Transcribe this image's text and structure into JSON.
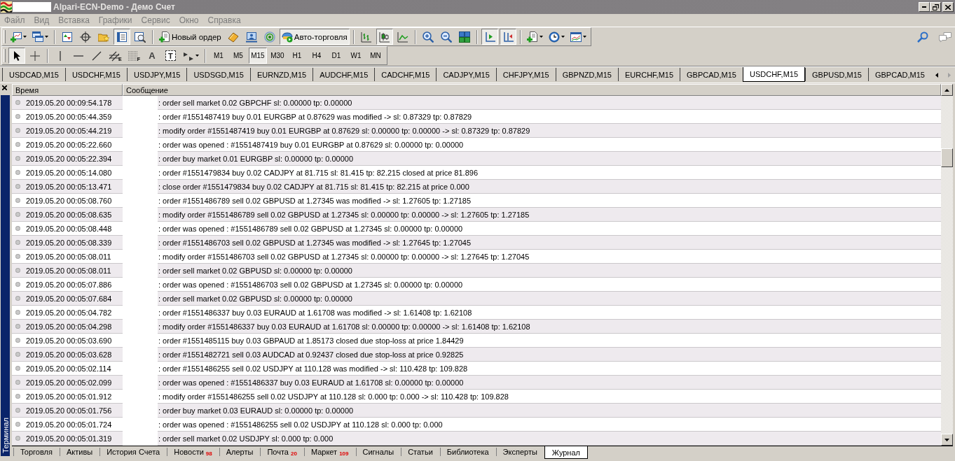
{
  "window": {
    "title": "Alpari-ECN-Demo - Демо Счет",
    "active": false
  },
  "menu": [
    "Файл",
    "Вид",
    "Вставка",
    "Графики",
    "Сервис",
    "Окно",
    "Справка"
  ],
  "main_toolbar": {
    "terminal": {
      "on": true
    },
    "new_order": {
      "label": "Новый ордер"
    },
    "auto_trading": {
      "label": "Авто-торговля",
      "on": true
    },
    "chart_types": [
      {
        "selected": false
      },
      {
        "selected": true
      },
      {
        "selected": false
      }
    ],
    "auto_scroll": {
      "on": true
    },
    "chart_shift": {
      "on": true
    }
  },
  "drawing_toolbar": {
    "cursor_modes": [
      {
        "selected": true
      },
      {
        "selected": false
      }
    ],
    "channel_mark": "E",
    "fibo_mark": "F",
    "text_tool": "A",
    "label_tool": "T"
  },
  "timeframes": [
    {
      "label": "M1",
      "selected": false
    },
    {
      "label": "M5",
      "selected": false
    },
    {
      "label": "M15",
      "selected": true
    },
    {
      "label": "M30",
      "selected": false
    },
    {
      "label": "H1",
      "selected": false
    },
    {
      "label": "H4",
      "selected": false
    },
    {
      "label": "D1",
      "selected": false
    },
    {
      "label": "W1",
      "selected": false
    },
    {
      "label": "MN",
      "selected": false
    }
  ],
  "chart_tabs": [
    {
      "label": "USDCAD,M15",
      "selected": false
    },
    {
      "label": "USDCHF,M15",
      "selected": false
    },
    {
      "label": "USDJPY,M15",
      "selected": false
    },
    {
      "label": "USDSGD,M15",
      "selected": false
    },
    {
      "label": "EURNZD,M15",
      "selected": false
    },
    {
      "label": "AUDCHF,M15",
      "selected": false
    },
    {
      "label": "CADCHF,M15",
      "selected": false
    },
    {
      "label": "CADJPY,M15",
      "selected": false
    },
    {
      "label": "CHFJPY,M15",
      "selected": false
    },
    {
      "label": "GBPNZD,M15",
      "selected": false
    },
    {
      "label": "EURCHF,M15",
      "selected": false
    },
    {
      "label": "GBPCAD,M15",
      "selected": false
    },
    {
      "label": "USDCHF,M15",
      "selected": true
    },
    {
      "label": "GBPUSD,M15",
      "selected": false
    },
    {
      "label": "GBPCAD,M15",
      "selected": false
    }
  ],
  "terminal": {
    "title": "Терминал",
    "columns": [
      "Время",
      "Сообщение"
    ],
    "rows": [
      {
        "time": "2019.05.20 00:09:54.178",
        "message": ": order sell market 0.02 GBPCHF sl: 0.00000 tp: 0.00000"
      },
      {
        "time": "2019.05.20 00:05:44.359",
        "message": ": order #1551487419 buy 0.01 EURGBP at 0.87629 was modified -> sl: 0.87329 tp: 0.87829"
      },
      {
        "time": "2019.05.20 00:05:44.219",
        "message": ": modify order #1551487419 buy 0.01 EURGBP at 0.87629 sl: 0.00000 tp: 0.00000 -> sl: 0.87329 tp: 0.87829"
      },
      {
        "time": "2019.05.20 00:05:22.660",
        "message": ": order was opened : #1551487419 buy 0.01 EURGBP at 0.87629 sl: 0.00000 tp: 0.00000"
      },
      {
        "time": "2019.05.20 00:05:22.394",
        "message": ": order buy market 0.01 EURGBP sl: 0.00000 tp: 0.00000"
      },
      {
        "time": "2019.05.20 00:05:14.080",
        "message": ": order #1551479834 buy 0.02 CADJPY at 81.715 sl: 81.415 tp: 82.215 closed at price 81.896"
      },
      {
        "time": "2019.05.20 00:05:13.471",
        "message": ": close order #1551479834 buy 0.02 CADJPY at 81.715 sl: 81.415 tp: 82.215 at price 0.000"
      },
      {
        "time": "2019.05.20 00:05:08.760",
        "message": ": order #1551486789 sell 0.02 GBPUSD at 1.27345 was modified -> sl: 1.27605 tp: 1.27185"
      },
      {
        "time": "2019.05.20 00:05:08.635",
        "message": ": modify order #1551486789 sell 0.02 GBPUSD at 1.27345 sl: 0.00000 tp: 0.00000 -> sl: 1.27605 tp: 1.27185"
      },
      {
        "time": "2019.05.20 00:05:08.448",
        "message": ": order was opened : #1551486789 sell 0.02 GBPUSD at 1.27345 sl: 0.00000 tp: 0.00000"
      },
      {
        "time": "2019.05.20 00:05:08.339",
        "message": ": order #1551486703 sell 0.02 GBPUSD at 1.27345 was modified -> sl: 1.27645 tp: 1.27045"
      },
      {
        "time": "2019.05.20 00:05:08.011",
        "message": ": modify order #1551486703 sell 0.02 GBPUSD at 1.27345 sl: 0.00000 tp: 0.00000 -> sl: 1.27645 tp: 1.27045"
      },
      {
        "time": "2019.05.20 00:05:08.011",
        "message": ": order sell market 0.02 GBPUSD sl: 0.00000 tp: 0.00000"
      },
      {
        "time": "2019.05.20 00:05:07.886",
        "message": ": order was opened : #1551486703 sell 0.02 GBPUSD at 1.27345 sl: 0.00000 tp: 0.00000"
      },
      {
        "time": "2019.05.20 00:05:07.684",
        "message": ": order sell market 0.02 GBPUSD sl: 0.00000 tp: 0.00000"
      },
      {
        "time": "2019.05.20 00:05:04.782",
        "message": ": order #1551486337 buy 0.03 EURAUD at 1.61708 was modified -> sl: 1.61408 tp: 1.62108"
      },
      {
        "time": "2019.05.20 00:05:04.298",
        "message": ": modify order #1551486337 buy 0.03 EURAUD at 1.61708 sl: 0.00000 tp: 0.00000 -> sl: 1.61408 tp: 1.62108"
      },
      {
        "time": "2019.05.20 00:05:03.690",
        "message": ": order #1551485115 buy 0.03 GBPAUD at 1.85173 closed due stop-loss at price 1.84429"
      },
      {
        "time": "2019.05.20 00:05:03.628",
        "message": ": order #1551482721 sell 0.03 AUDCAD at 0.92437 closed due stop-loss at price 0.92825"
      },
      {
        "time": "2019.05.20 00:05:02.114",
        "message": ": order #1551486255 sell 0.02 USDJPY at 110.128 was modified -> sl: 110.428 tp: 109.828"
      },
      {
        "time": "2019.05.20 00:05:02.099",
        "message": ": order was opened : #1551486337 buy 0.03 EURAUD at 1.61708 sl: 0.00000 tp: 0.00000"
      },
      {
        "time": "2019.05.20 00:05:01.912",
        "message": ": modify order #1551486255 sell 0.02 USDJPY at 110.128 sl: 0.000 tp: 0.000 -> sl: 110.428 tp: 109.828"
      },
      {
        "time": "2019.05.20 00:05:01.756",
        "message": ": order buy market 0.03 EURAUD sl: 0.00000 tp: 0.00000"
      },
      {
        "time": "2019.05.20 00:05:01.724",
        "message": ": order was opened : #1551486255 sell 0.02 USDJPY at 110.128 sl: 0.000 tp: 0.000"
      },
      {
        "time": "2019.05.20 00:05:01.319",
        "message": ": order sell market 0.02 USDJPY sl: 0.000 tp: 0.000"
      }
    ],
    "tabs": [
      {
        "label": "Торговля",
        "selected": false
      },
      {
        "label": "Активы",
        "selected": false
      },
      {
        "label": "История Счета",
        "selected": false
      },
      {
        "label": "Новости",
        "badge": "98",
        "selected": false
      },
      {
        "label": "Алерты",
        "selected": false
      },
      {
        "label": "Почта",
        "badge": "20",
        "selected": false
      },
      {
        "label": "Маркет",
        "badge": "109",
        "selected": false
      },
      {
        "label": "Сигналы",
        "selected": false
      },
      {
        "label": "Статьи",
        "selected": false
      },
      {
        "label": "Библиотека",
        "selected": false
      },
      {
        "label": "Эксперты",
        "selected": false
      },
      {
        "label": "Журнал",
        "selected": true
      }
    ]
  }
}
